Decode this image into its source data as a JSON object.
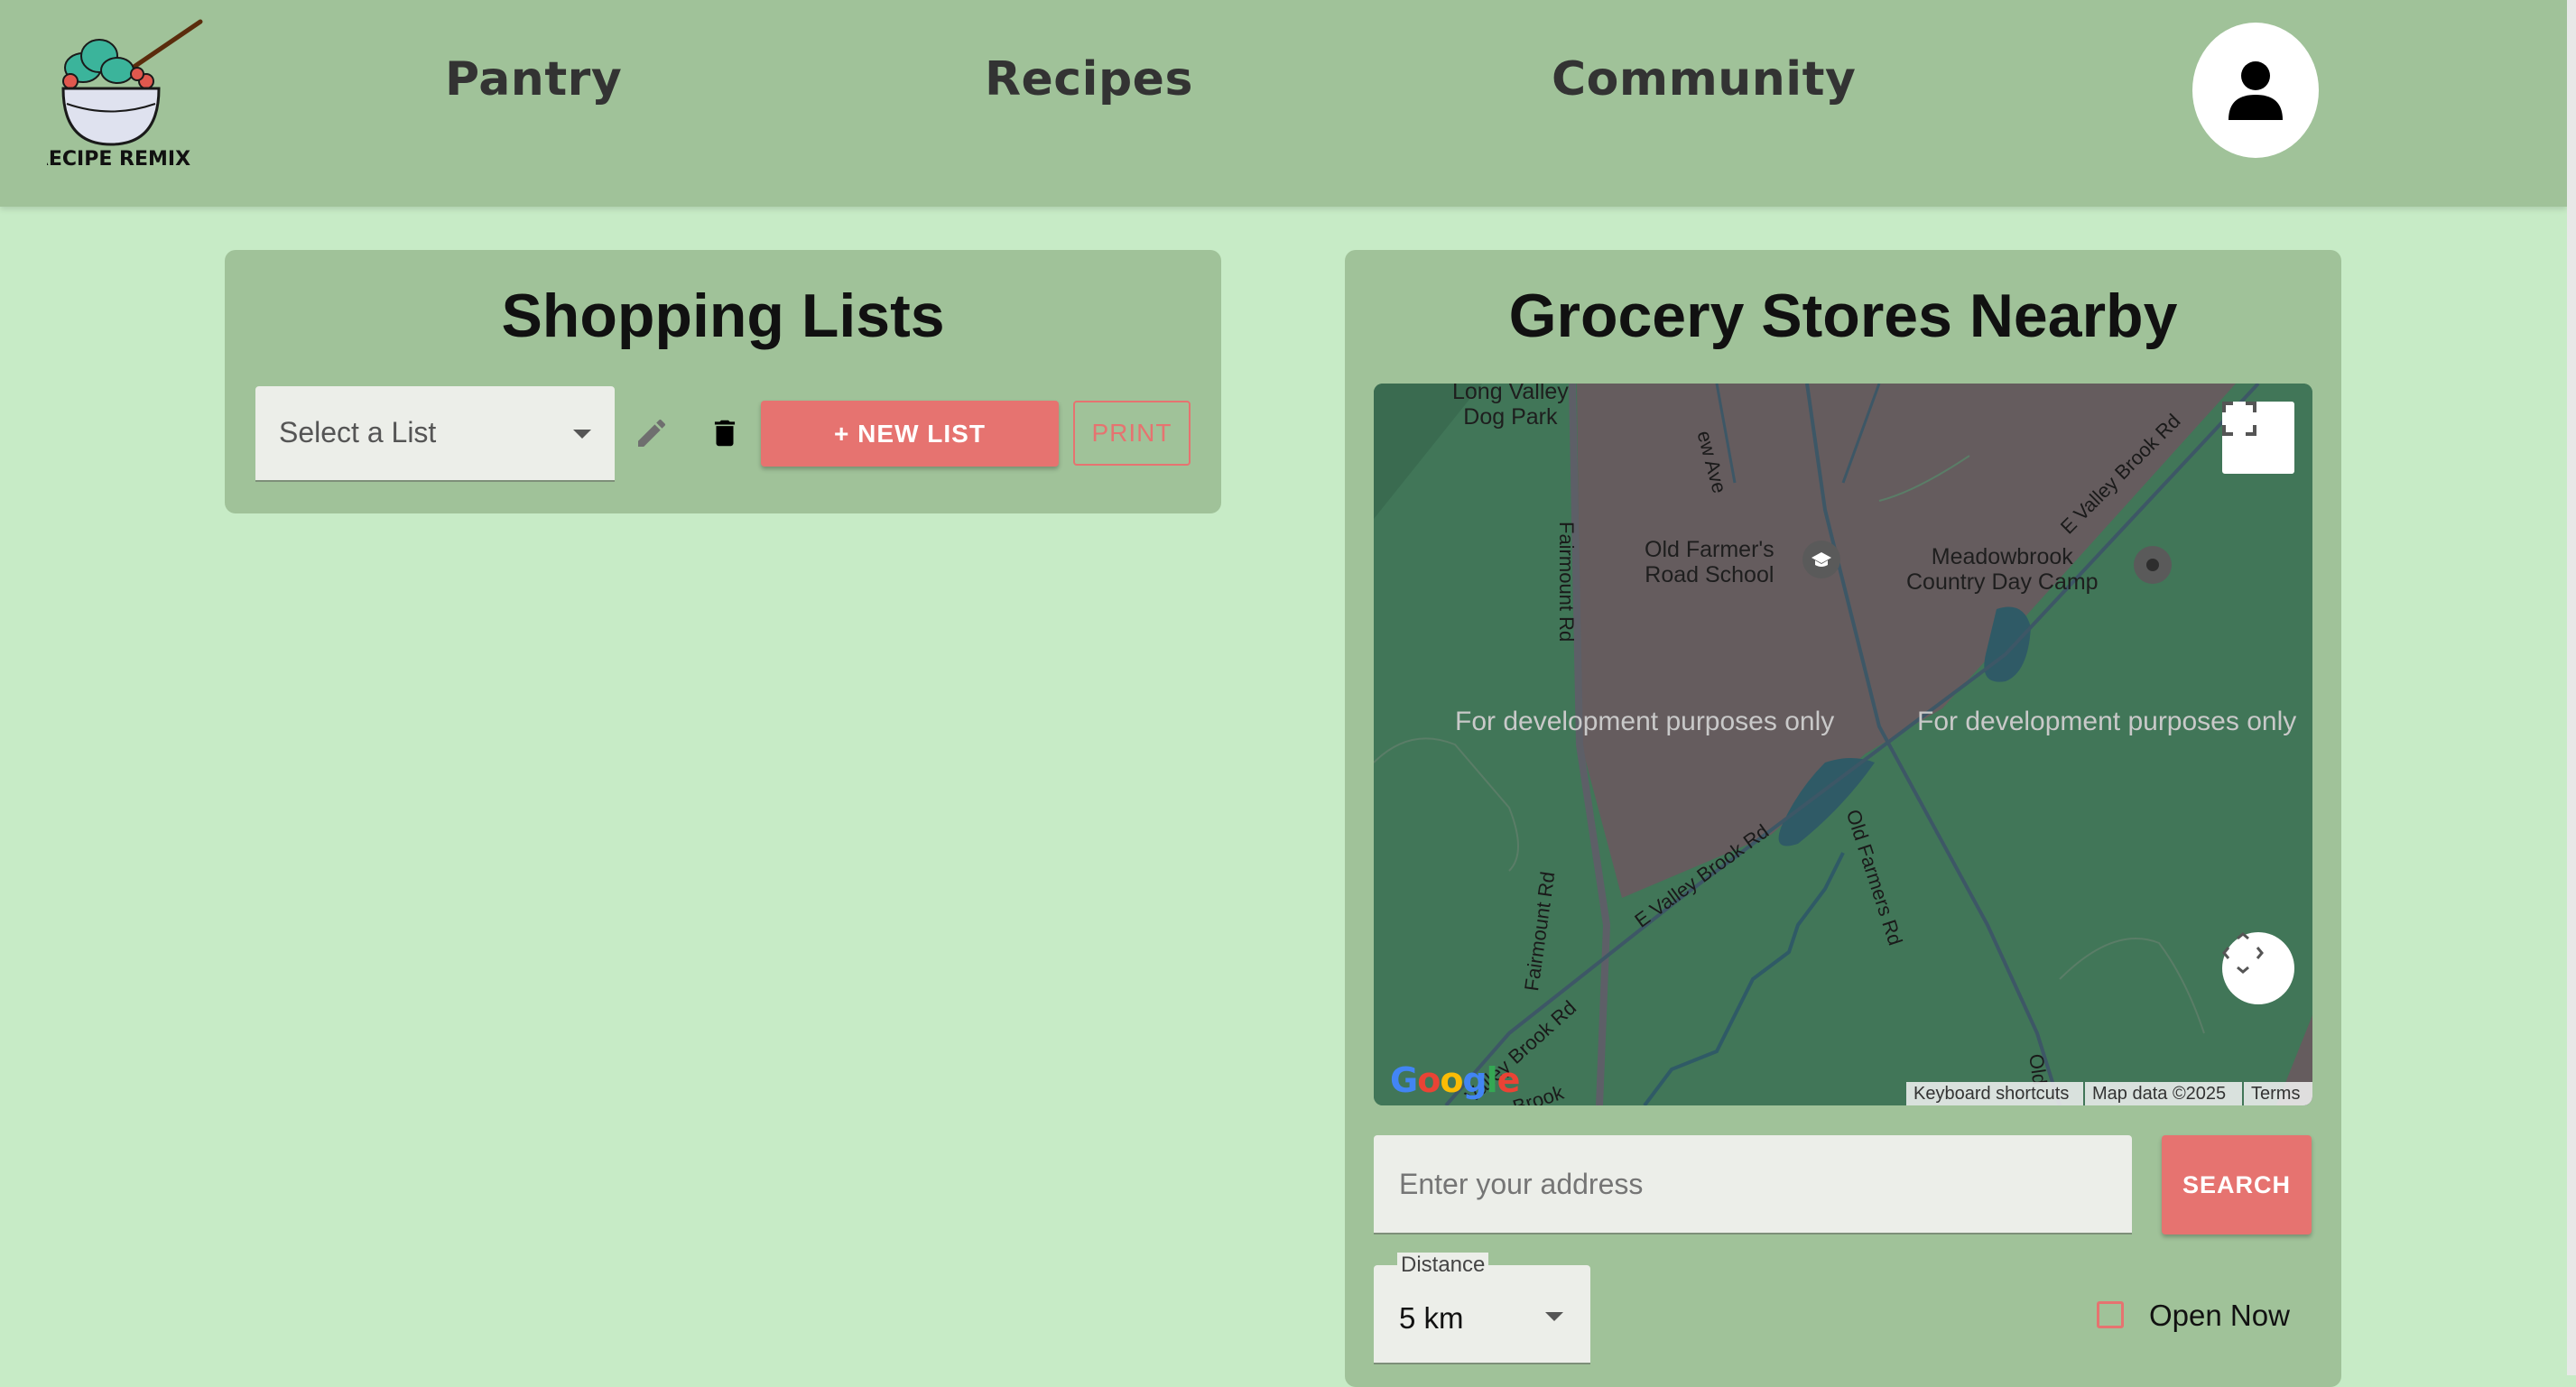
{
  "brand": {
    "logo_text": "RECIPE REMIX"
  },
  "nav": {
    "links": [
      "Pantry",
      "Recipes",
      "Community"
    ]
  },
  "shopping": {
    "title": "Shopping Lists",
    "select_placeholder": "Select a List",
    "new_list_label": "+ NEW LIST",
    "print_label": "PRINT"
  },
  "stores": {
    "title": "Grocery Stores Nearby",
    "map": {
      "places": {
        "park": "Long Valley\nDog Park",
        "school": "Old Farmer's\nRoad School",
        "camp": "Meadowbrook\nCountry Day Camp"
      },
      "streets": {
        "fairmount_1": "Fairmount Rd",
        "fairmount_2": "Fairmount Rd",
        "new_ave": "ew Ave",
        "evalley_1": "E Valley Brook Rd",
        "evalley_2": "E Valley Brook Rd",
        "valley_brook_sw": "Valley Brook Rd",
        "old_farmers": "Old Farmers Rd",
        "old_partial": "Old",
        "brook_partial": "Brook"
      },
      "dev_notes": [
        "For development purposes only",
        "For development purposes only"
      ],
      "attribution": {
        "shortcuts": "Keyboard shortcuts",
        "data": "Map data ©2025",
        "terms": "Terms"
      },
      "logo_text": "Google"
    },
    "address_placeholder": "Enter your address",
    "search_label": "SEARCH",
    "distance_label": "Distance",
    "distance_value": "5 km",
    "open_now_label": "Open Now"
  },
  "colors": {
    "page_bg": "#c7ebc6",
    "header_bg": "#a0c299",
    "accent": "#e67370",
    "map_green": "#417658",
    "map_land": "#655c5e"
  }
}
